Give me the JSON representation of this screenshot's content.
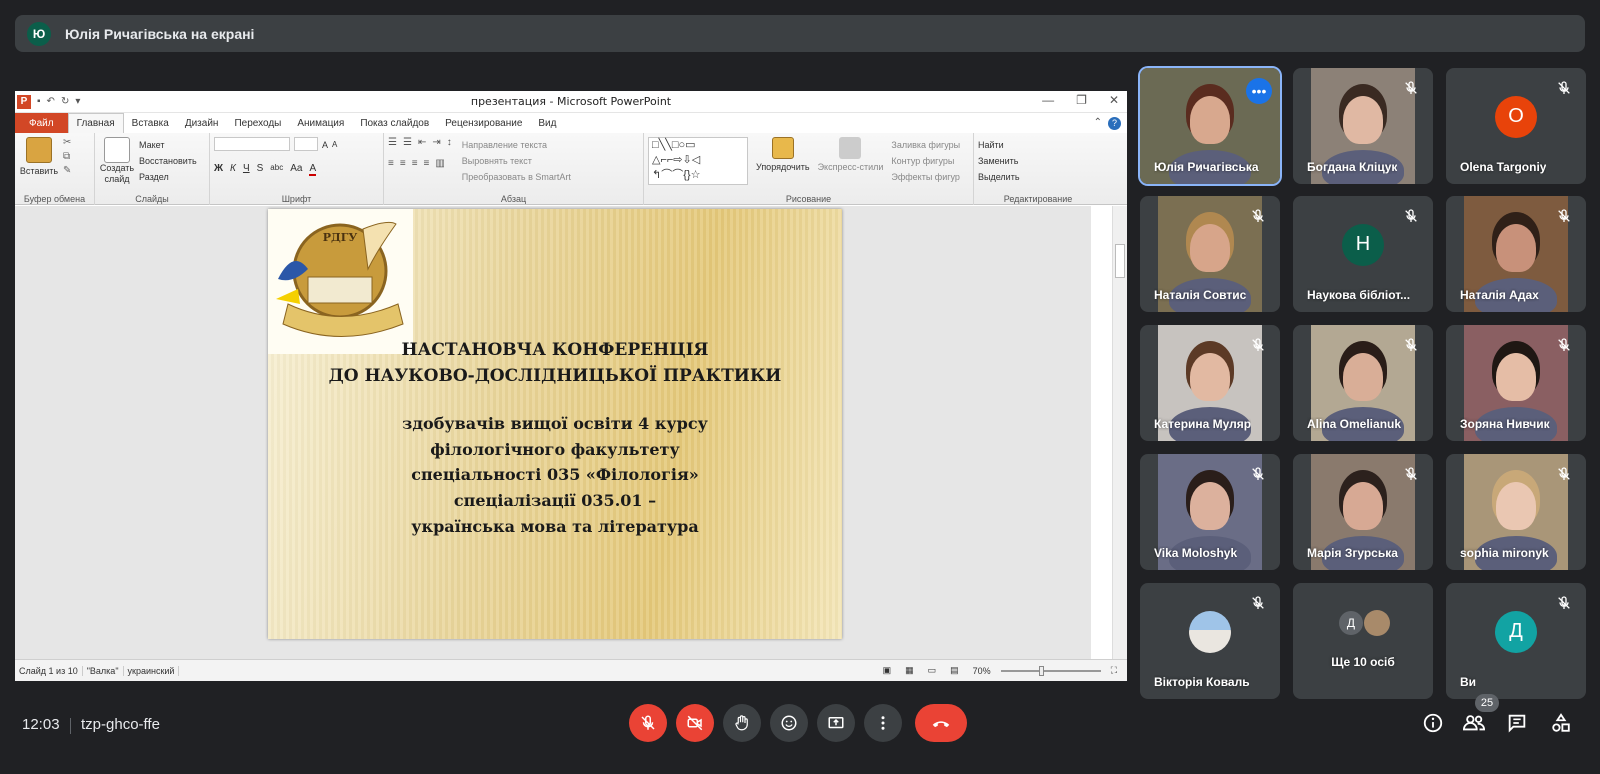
{
  "presenter_bar": {
    "avatar_letter": "Ю",
    "title": "Юлія Ричагівська на екрані"
  },
  "ppt": {
    "window_title": "презентация - Microsoft PowerPoint",
    "logo_letter": "P",
    "window_controls": [
      "—",
      "❐",
      "✕"
    ],
    "tabs": [
      "Файл",
      "Главная",
      "Вставка",
      "Дизайн",
      "Переходы",
      "Анимация",
      "Показ слайдов",
      "Рецензирование",
      "Вид"
    ],
    "ribbon": {
      "clipboard": {
        "paste": "Вставить",
        "group": "Буфер обмена"
      },
      "slides": {
        "new_slide": "Создать слайд",
        "layout": "Макет",
        "reset": "Восстановить",
        "section": "Раздел",
        "group": "Слайды"
      },
      "font": {
        "bold": "Ж",
        "italic": "К",
        "underline": "Ч",
        "strike": "S",
        "spacing": "abc",
        "case": "Aa",
        "grow": "A",
        "shrink": "A",
        "color": "A",
        "group": "Шрифт"
      },
      "paragraph": {
        "direction": "Направление текста",
        "align": "Выровнять текст",
        "smartart": "Преобразовать в SmartArt",
        "group": "Абзац"
      },
      "drawing": {
        "arrange": "Упорядочить",
        "quick_styles": "Экспресс-стили",
        "fill": "Заливка фигуры",
        "outline": "Контур фигуры",
        "effects": "Эффекты фигур",
        "group": "Рисование"
      },
      "editing": {
        "find": "Найти",
        "replace": "Заменить",
        "select": "Выделить",
        "group": "Редактирование"
      }
    },
    "slide": {
      "logo_text": "РДГУ",
      "title_line1": "НАСТАНОВЧА КОНФЕРЕНЦІЯ",
      "title_line2": "ДО НАУКОВО-ДОСЛІДНИЦЬКОЇ ПРАКТИКИ",
      "body": [
        "здобувачів вищої освіти 4 курсу",
        "філологічного факультету",
        "спеціальності 035 «Філологія»",
        "спеціалізації 035.01 –",
        "українська мова та література"
      ]
    },
    "status": {
      "slide": "Слайд 1 из 10",
      "theme": "\"Валка\"",
      "lang": "украинский",
      "zoom": "70%"
    }
  },
  "participants": [
    {
      "name": "Юлія Ричагівська",
      "type": "video",
      "active": true
    },
    {
      "name": "Богдана Кліцук",
      "type": "video"
    },
    {
      "name": "Olena Targoniy",
      "type": "letter",
      "letter": "O",
      "color": "#e8430a"
    },
    {
      "name": "Наталія Совтис",
      "type": "video"
    },
    {
      "name": "Наукова бібліот...",
      "type": "letter",
      "letter": "Н",
      "color": "#0b5e4a"
    },
    {
      "name": "Наталія Адах",
      "type": "video"
    },
    {
      "name": "Катерина Муляр",
      "type": "video"
    },
    {
      "name": "Alina Omelianuk",
      "type": "video"
    },
    {
      "name": "Зоряна Нивчик",
      "type": "video"
    },
    {
      "name": "Vika Moloshyk",
      "type": "video"
    },
    {
      "name": "Марія Згурська",
      "type": "video"
    },
    {
      "name": "sophia mironyk",
      "type": "video"
    },
    {
      "name": "Вікторія Коваль",
      "type": "avatar"
    },
    {
      "name": "Ще 10 осіб",
      "type": "more",
      "letter": "Д"
    },
    {
      "name": "Ви",
      "type": "letter",
      "letter": "Д",
      "color": "#12a3a3"
    }
  ],
  "bottom": {
    "time": "12:03",
    "meeting_code": "tzp-ghco-ffe",
    "participant_count": "25"
  }
}
